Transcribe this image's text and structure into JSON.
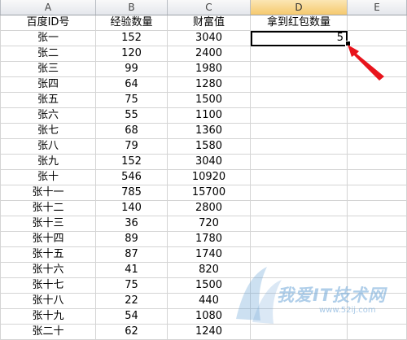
{
  "columns": [
    "A",
    "B",
    "C",
    "D",
    "E"
  ],
  "headers": {
    "a": "百度ID号",
    "b": "经验数量",
    "c": "财富值",
    "d": "拿到红包数量"
  },
  "active_cell_value": "5",
  "rows": [
    {
      "name": "张一",
      "exp": "152",
      "wealth": "3040"
    },
    {
      "name": "张二",
      "exp": "120",
      "wealth": "2400"
    },
    {
      "name": "张三",
      "exp": "99",
      "wealth": "1980"
    },
    {
      "name": "张四",
      "exp": "64",
      "wealth": "1280"
    },
    {
      "name": "张五",
      "exp": "75",
      "wealth": "1500"
    },
    {
      "name": "张六",
      "exp": "55",
      "wealth": "1100"
    },
    {
      "name": "张七",
      "exp": "68",
      "wealth": "1360"
    },
    {
      "name": "张八",
      "exp": "79",
      "wealth": "1580"
    },
    {
      "name": "张九",
      "exp": "152",
      "wealth": "3040"
    },
    {
      "name": "张十",
      "exp": "546",
      "wealth": "10920"
    },
    {
      "name": "张十一",
      "exp": "785",
      "wealth": "15700"
    },
    {
      "name": "张十二",
      "exp": "140",
      "wealth": "2800"
    },
    {
      "name": "张十三",
      "exp": "36",
      "wealth": "720"
    },
    {
      "name": "张十四",
      "exp": "89",
      "wealth": "1780"
    },
    {
      "name": "张十五",
      "exp": "87",
      "wealth": "1740"
    },
    {
      "name": "张十六",
      "exp": "41",
      "wealth": "820"
    },
    {
      "name": "张十七",
      "exp": "75",
      "wealth": "1500"
    },
    {
      "name": "张十八",
      "exp": "22",
      "wealth": "440"
    },
    {
      "name": "张十九",
      "exp": "54",
      "wealth": "1080"
    },
    {
      "name": "张二十",
      "exp": "62",
      "wealth": "1240"
    }
  ],
  "watermark": {
    "main": "我爱IT技术网",
    "sub": "www.52ij.com"
  },
  "colors": {
    "arrow": "#e8141c",
    "selected_header": "#f5c96e",
    "gridline": "#d4d4d4"
  }
}
